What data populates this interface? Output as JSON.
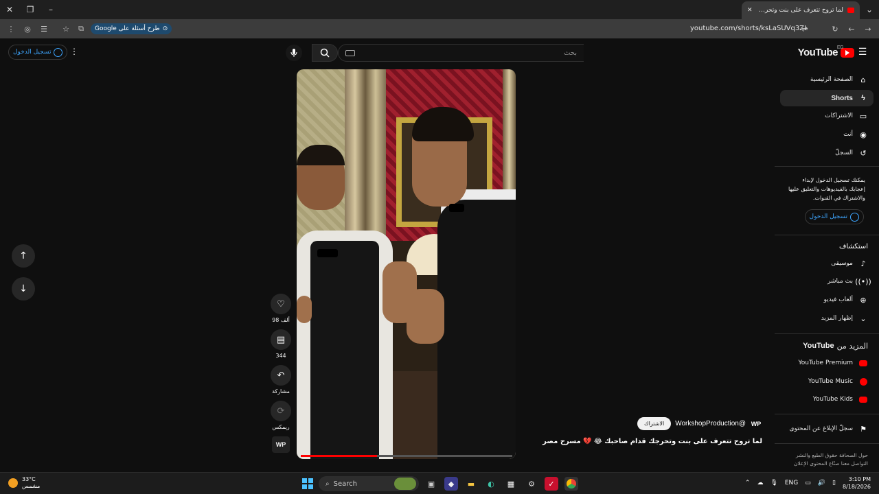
{
  "browser": {
    "tab_title": "لما تروح تتعرف على بنت وتحرجك قدام صاحبك",
    "url": "youtube.com/shorts/ksLaSUVq3ZI",
    "google_chip": "طرح أسئلة على Google"
  },
  "header": {
    "logo_text": "YouTube",
    "logo_sup": "EG",
    "search_placeholder": "بحث",
    "signin_label": "تسجيل الدخول"
  },
  "sidebar": {
    "main": [
      {
        "label": "الصفحة الرئيسية",
        "icon": "home-icon"
      },
      {
        "label": "Shorts",
        "icon": "shorts-icon"
      },
      {
        "label": "الاشتراكات",
        "icon": "subscriptions-icon"
      },
      {
        "label": "أنت",
        "icon": "account-icon"
      },
      {
        "label": "السجلّ",
        "icon": "history-icon"
      }
    ],
    "signin_note": "يمكنك تسجيل الدخول لإبداء إعجابك بالفيديوهات والتعليق عليها والاشتراك في القنوات.",
    "signin_label": "تسجيل الدخول",
    "explore_title": "استكشاف",
    "explore": [
      {
        "label": "موسيقى",
        "icon": "music-icon"
      },
      {
        "label": "بث مباشر",
        "icon": "live-icon"
      },
      {
        "label": "ألعاب فيديو",
        "icon": "gaming-icon"
      },
      {
        "label": "إظهار المزيد",
        "icon": "chevron-down-icon"
      }
    ],
    "more_title_prefix": "المزيد من",
    "more_title_brand": "YouTube",
    "more": [
      {
        "label": "YouTube Premium"
      },
      {
        "label": "YouTube Music"
      },
      {
        "label": "YouTube Kids"
      }
    ],
    "report": "سجلّ الإبلاغ عن المحتوى",
    "footer": "حول  الصحافة  حقوق الطبع والنشر  التواصل معنا  صنّاع المحتوى  الإعلان"
  },
  "video": {
    "title": "لما تروح تتعرف على بنت وتحرجك قدام صاحبك 😂 💔 مسرح مصر",
    "channel": "@WorkshopProduction",
    "channel_logo": "WP",
    "subscribe": "الاشتراك",
    "progress": 0.36
  },
  "actions": {
    "likes": "98 ألف",
    "comments": "344",
    "share": "مشاركة",
    "remix": "ريمكس"
  },
  "taskbar": {
    "temp": "33°C",
    "condition": "مشمس",
    "search": "Search",
    "lang": "ENG",
    "time": "3:10 PM",
    "date": "8/18/2026"
  },
  "colors": {
    "brand": "#ff0000",
    "link": "#3ea6ff",
    "bg": "#0f0f0f"
  }
}
